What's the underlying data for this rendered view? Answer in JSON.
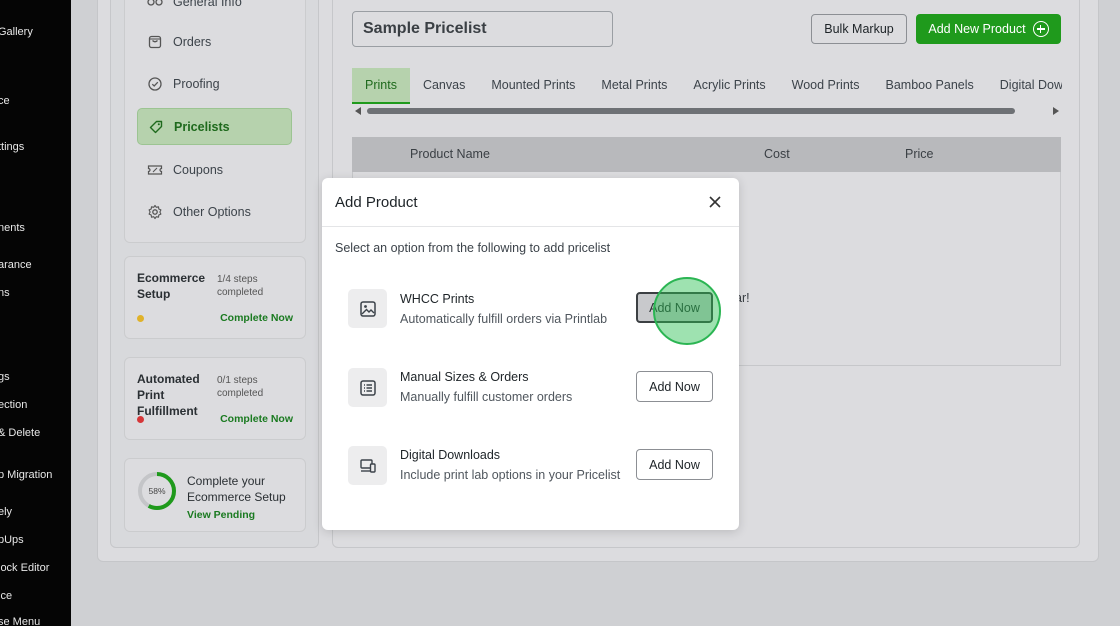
{
  "wp_sidebar": {
    "items": [
      {
        "label": "Gallery",
        "top": 0
      },
      {
        "label": "ce"
      },
      {
        "label": "ttings"
      },
      {
        "label": "nents"
      },
      {
        "label": "arance"
      },
      {
        "label": "ns"
      },
      {
        "label": "gs"
      },
      {
        "label": "ection"
      },
      {
        "label": "& Delete"
      },
      {
        "label": "p Migration"
      },
      {
        "label": "ely"
      },
      {
        "label": "pUps"
      },
      {
        "label": "lock Editor"
      },
      {
        "label": "ice"
      },
      {
        "label": "se Menu"
      }
    ]
  },
  "nav": {
    "items": [
      {
        "label": "General Info",
        "icon": "general-info-icon"
      },
      {
        "label": "Orders",
        "icon": "orders-icon"
      },
      {
        "label": "Proofing",
        "icon": "proofing-icon"
      },
      {
        "label": "Pricelists",
        "icon": "tag-icon",
        "active": true
      },
      {
        "label": "Coupons",
        "icon": "coupon-icon"
      },
      {
        "label": "Other Options",
        "icon": "gear-icon"
      }
    ]
  },
  "setup": {
    "ecommerce": {
      "title": "Ecommerce Setup",
      "steps": "1/4 steps completed",
      "link": "Complete Now",
      "dot_color": "#e0b22a"
    },
    "print": {
      "title": "Automated Print Fulfillment",
      "steps": "0/1 steps completed",
      "link": "Complete Now",
      "dot_color": "#d63638"
    },
    "progress": {
      "percent_label": "58%",
      "percent": 58,
      "title": "Complete your Ecommerce Setup",
      "link": "View Pending",
      "color": "#1f9a1c"
    }
  },
  "main": {
    "pricelist_name": "Sample Pricelist",
    "bulk_markup": "Bulk Markup",
    "add_new_product": "Add New Product",
    "tabs": [
      "Prints",
      "Canvas",
      "Mounted Prints",
      "Metal Prints",
      "Acrylic Prints",
      "Wood Prints",
      "Bamboo Panels",
      "Digital Downl"
    ],
    "columns": [
      "Product Name",
      "Cost",
      "Price"
    ],
    "empty_text_fragment": "ar!"
  },
  "modal": {
    "title": "Add Product",
    "subtitle": "Select an option from the following to add pricelist",
    "options": [
      {
        "title": "WHCC Prints",
        "desc": "Automatically fulfill orders via Printlab",
        "button": "Add Now",
        "icon": "image-icon"
      },
      {
        "title": "Manual Sizes & Orders",
        "desc": "Manually fulfill customer orders",
        "button": "Add Now",
        "icon": "list-icon"
      },
      {
        "title": "Digital Downloads",
        "desc": "Include print lab options in your Pricelist",
        "button": "Add Now",
        "icon": "devices-icon"
      }
    ]
  },
  "colors": {
    "accent": "#1f9a1c",
    "active_bg": "#b6d2ad"
  }
}
